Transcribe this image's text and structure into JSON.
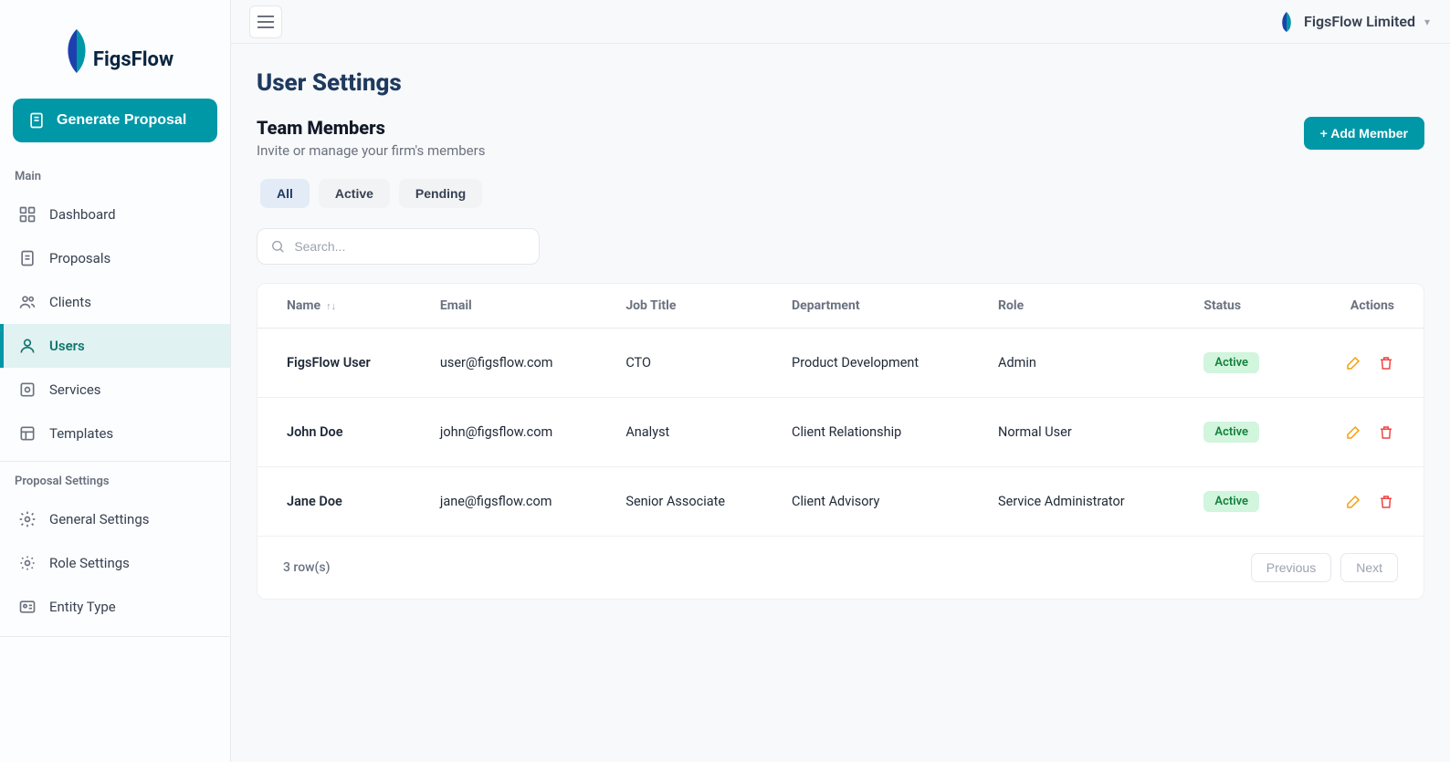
{
  "brand": {
    "name": "FigsFlow"
  },
  "sidebar": {
    "generate_label": "Generate Proposal",
    "sections": {
      "main": {
        "label": "Main"
      },
      "proposal_settings": {
        "label": "Proposal Settings"
      }
    },
    "items": {
      "dashboard": "Dashboard",
      "proposals": "Proposals",
      "clients": "Clients",
      "users": "Users",
      "services": "Services",
      "templates": "Templates",
      "general_settings": "General Settings",
      "role_settings": "Role Settings",
      "entity_type": "Entity Type"
    }
  },
  "topbar": {
    "firm_name": "FigsFlow Limited"
  },
  "page": {
    "title": "User Settings"
  },
  "team": {
    "title": "Team Members",
    "subtitle": "Invite or manage your firm's members",
    "add_button": "+ Add Member"
  },
  "filters": {
    "all": "All",
    "active": "Active",
    "pending": "Pending",
    "selected": "all"
  },
  "search": {
    "placeholder": "Search..."
  },
  "table": {
    "columns": {
      "name": "Name",
      "email": "Email",
      "job_title": "Job Title",
      "department": "Department",
      "role": "Role",
      "status": "Status",
      "actions": "Actions"
    },
    "rows": [
      {
        "name": "FigsFlow User",
        "email": "user@figsflow.com",
        "job_title": "CTO",
        "department": "Product Development",
        "role": "Admin",
        "status": "Active"
      },
      {
        "name": "John Doe",
        "email": "john@figsflow.com",
        "job_title": "Analyst",
        "department": "Client Relationship",
        "role": "Normal User",
        "status": "Active"
      },
      {
        "name": "Jane Doe",
        "email": "jane@figsflow.com",
        "job_title": "Senior Associate",
        "department": "Client Advisory",
        "role": "Service Administrator",
        "status": "Active"
      }
    ],
    "footer": {
      "rows_label": "3 row(s)",
      "prev": "Previous",
      "next": "Next"
    }
  }
}
